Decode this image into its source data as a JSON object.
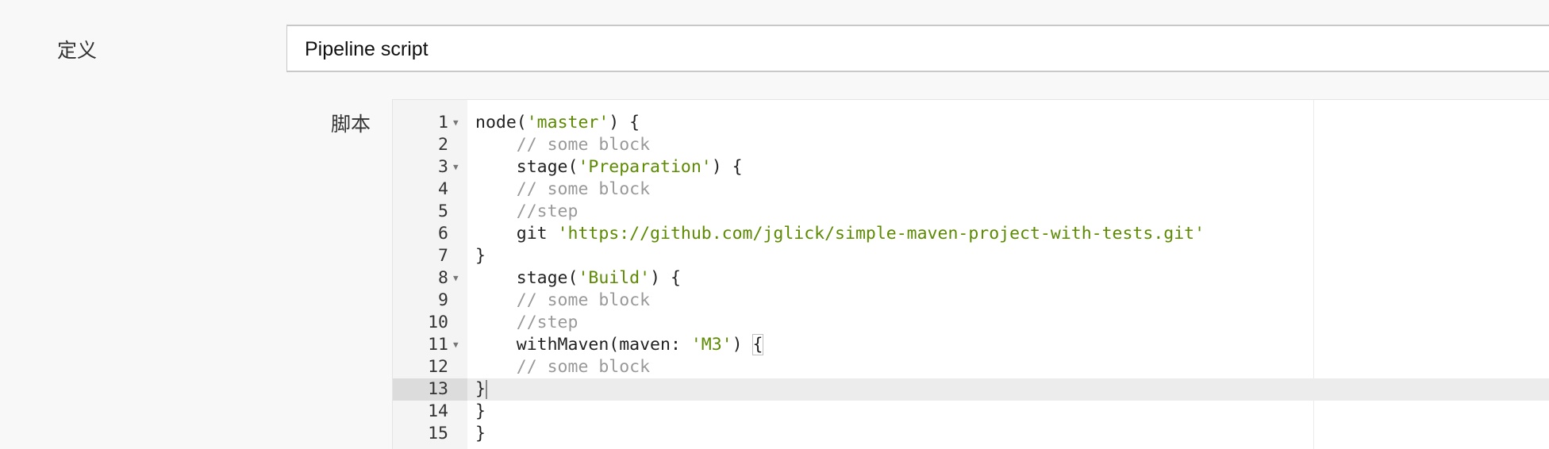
{
  "definition": {
    "label": "定义",
    "selected": "Pipeline script"
  },
  "script": {
    "label": "脚本",
    "active_line": 13,
    "lines": [
      {
        "n": "1",
        "fold": true,
        "segs": [
          {
            "t": "node(",
            "c": "plain"
          },
          {
            "t": "'master'",
            "c": "string"
          },
          {
            "t": ") {",
            "c": "plain"
          }
        ]
      },
      {
        "n": "2",
        "fold": false,
        "segs": [
          {
            "t": "    ",
            "c": "plain"
          },
          {
            "t": "// some block",
            "c": "comment"
          }
        ]
      },
      {
        "n": "3",
        "fold": true,
        "segs": [
          {
            "t": "    stage(",
            "c": "plain"
          },
          {
            "t": "'Preparation'",
            "c": "string"
          },
          {
            "t": ") {",
            "c": "plain"
          }
        ]
      },
      {
        "n": "4",
        "fold": false,
        "segs": [
          {
            "t": "    ",
            "c": "plain"
          },
          {
            "t": "// some block",
            "c": "comment"
          }
        ]
      },
      {
        "n": "5",
        "fold": false,
        "segs": [
          {
            "t": "    ",
            "c": "plain"
          },
          {
            "t": "//step",
            "c": "comment"
          }
        ]
      },
      {
        "n": "6",
        "fold": false,
        "segs": [
          {
            "t": "    git ",
            "c": "plain"
          },
          {
            "t": "'https://github.com/jglick/simple-maven-project-with-tests.git'",
            "c": "string"
          }
        ]
      },
      {
        "n": "7",
        "fold": false,
        "segs": [
          {
            "t": "}",
            "c": "plain"
          }
        ]
      },
      {
        "n": "8",
        "fold": true,
        "segs": [
          {
            "t": "    stage(",
            "c": "plain"
          },
          {
            "t": "'Build'",
            "c": "string"
          },
          {
            "t": ") {",
            "c": "plain"
          }
        ]
      },
      {
        "n": "9",
        "fold": false,
        "segs": [
          {
            "t": "    ",
            "c": "plain"
          },
          {
            "t": "// some block",
            "c": "comment"
          }
        ]
      },
      {
        "n": "10",
        "fold": false,
        "segs": [
          {
            "t": "    ",
            "c": "plain"
          },
          {
            "t": "//step",
            "c": "comment"
          }
        ]
      },
      {
        "n": "11",
        "fold": true,
        "segs": [
          {
            "t": "    withMaven(maven: ",
            "c": "plain"
          },
          {
            "t": "'M3'",
            "c": "string"
          },
          {
            "t": ") ",
            "c": "plain"
          },
          {
            "t": "{",
            "c": "bracket"
          }
        ]
      },
      {
        "n": "12",
        "fold": false,
        "segs": [
          {
            "t": "    ",
            "c": "plain"
          },
          {
            "t": "// some block",
            "c": "comment"
          }
        ]
      },
      {
        "n": "13",
        "fold": false,
        "segs": [
          {
            "t": "}",
            "c": "plain"
          }
        ]
      },
      {
        "n": "14",
        "fold": false,
        "segs": [
          {
            "t": "}",
            "c": "plain"
          }
        ]
      },
      {
        "n": "15",
        "fold": false,
        "segs": [
          {
            "t": "}",
            "c": "plain"
          }
        ]
      }
    ]
  }
}
